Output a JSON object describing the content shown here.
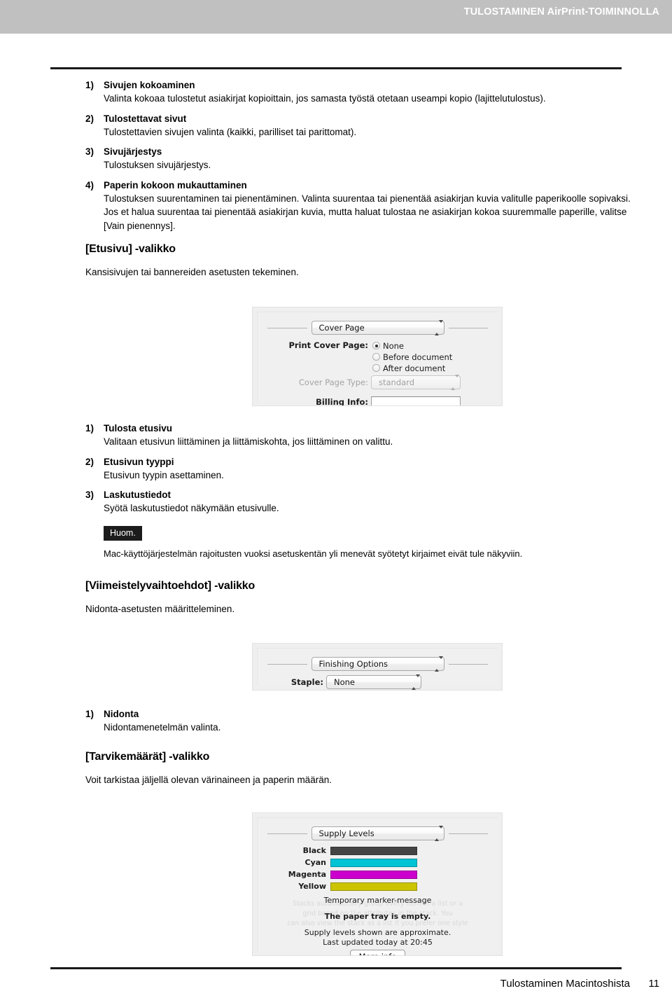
{
  "header": {
    "title": "TULOSTAMINEN AirPrint-TOIMINNOLLA"
  },
  "list_top": [
    {
      "marker": "1)",
      "title": "Sivujen kokoaminen",
      "desc": "Valinta kokoaa tulostetut asiakirjat kopioittain, jos samasta työstä otetaan useampi kopio (lajittelutulostus)."
    },
    {
      "marker": "2)",
      "title": "Tulostettavat sivut",
      "desc": "Tulostettavien sivujen valinta (kaikki, parilliset tai parittomat)."
    },
    {
      "marker": "3)",
      "title": "Sivujärjestys",
      "desc": "Tulostuksen sivujärjestys."
    },
    {
      "marker": "4)",
      "title": "Paperin kokoon mukauttaminen",
      "desc": "Tulostuksen suurentaminen tai pienentäminen. Valinta suurentaa tai pienentää asiakirjan kuvia valitulle paperikoolle sopivaksi. Jos et halua suurentaa tai pienentää asiakirjan kuvia, mutta haluat tulostaa ne asiakirjan kokoa suuremmalle paperille, valitse [Vain pienennys]."
    }
  ],
  "cover_section": {
    "heading": "[Etusivu] -valikko",
    "sub": "Kansisivujen tai bannereiden asetusten tekeminen."
  },
  "cover_dialog": {
    "popup_title": "Cover Page",
    "print_cover_page_label": "Print Cover Page:",
    "radios": [
      {
        "label": "None",
        "selected": true
      },
      {
        "label": "Before document",
        "selected": false
      },
      {
        "label": "After document",
        "selected": false
      }
    ],
    "cover_page_type_label": "Cover Page Type:",
    "cover_page_type_value": "standard",
    "billing_info_label": "Billing Info:",
    "billing_info_value": ""
  },
  "list_cover": [
    {
      "marker": "1)",
      "title": "Tulosta etusivu",
      "desc": "Valitaan etusivun liittäminen ja liittämiskohta, jos liittäminen on valittu."
    },
    {
      "marker": "2)",
      "title": "Etusivun tyyppi",
      "desc": "Etusivun tyypin asettaminen."
    },
    {
      "marker": "3)",
      "title": "Laskutustiedot",
      "desc": "Syötä laskutustiedot näkymään etusivulle."
    }
  ],
  "note": {
    "label": "Huom.",
    "text": "Mac-käyttöjärjestelmän rajoitusten vuoksi asetuskentän yli menevät syötetyt kirjaimet eivät tule näkyviin."
  },
  "finishing_section": {
    "heading": "[Viimeistelyvaihtoehdot] -valikko",
    "sub": "Nidonta-asetusten määritteleminen."
  },
  "finishing_dialog": {
    "popup_title": "Finishing Options",
    "staple_label": "Staple:",
    "staple_value": "None"
  },
  "list_finishing": [
    {
      "marker": "1)",
      "title": "Nidonta",
      "desc": "Nidontamenetelmän valinta."
    }
  ],
  "supply_section": {
    "heading": "[Tarvikemäärät] -valikko",
    "sub": "Voit tarkistaa jäljellä olevan värinaineen ja paperin määrän."
  },
  "supply_dialog": {
    "popup_title": "Supply Levels",
    "levels": [
      {
        "name": "Black",
        "color": "#444444"
      },
      {
        "name": "Cyan",
        "color": "#00c3d4"
      },
      {
        "name": "Magenta",
        "color": "#cc00cc"
      },
      {
        "name": "Yellow",
        "color": "#ccc400"
      }
    ],
    "marker_message": "Temporary marker-message",
    "tray_message": "The paper tray is empty.",
    "approximate_message": "Supply levels shown are approximate.",
    "last_updated": "Last updated today at 20:45",
    "more_info_label": "More info",
    "ghost_text": "Stacks automatically group every item in a list or a\ngrid based on the attributes in the stack. You\ncan also view the stack as a list if you prefer one style"
  },
  "footer": {
    "title": "Tulostaminen Macintoshista",
    "page": "11"
  }
}
